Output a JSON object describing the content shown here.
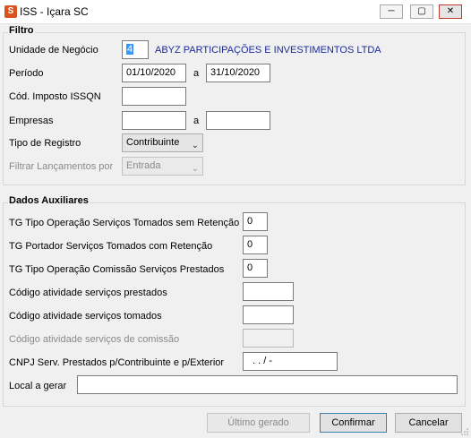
{
  "window": {
    "title": "ISS - Içara SC",
    "icon": "app-icon",
    "minimize_glyph": "─",
    "maximize_glyph": "▢",
    "close_glyph": "✕"
  },
  "filtro": {
    "title": "Filtro",
    "unidade_label": "Unidade de Negócio",
    "unidade_code": "4",
    "unidade_name": "ABYZ PARTICIPAÇÕES E INVESTIMENTOS LTDA",
    "periodo_label": "Período",
    "periodo_from": "01/10/2020",
    "periodo_sep": "a",
    "periodo_to": "31/10/2020",
    "cod_imposto_label": "Cód. Imposto ISSQN",
    "cod_imposto_value": "",
    "empresas_label": "Empresas",
    "empresas_from": "",
    "empresas_sep": "a",
    "empresas_to": "",
    "tipo_registro_label": "Tipo de Registro",
    "tipo_registro_value": "Contribuinte",
    "filtrar_label": "Filtrar Lançamentos por",
    "filtrar_value": "Entrada"
  },
  "aux": {
    "title": "Dados Auxiliares",
    "tg_tomados_label": "TG Tipo Operação Serviços Tomados sem Retenção",
    "tg_tomados_value": "0",
    "tg_portador_label": "TG Portador Serviços Tomados com Retenção",
    "tg_portador_value": "0",
    "tg_comissao_label": "TG Tipo Operação Comissão Serviços Prestados",
    "tg_comissao_value": "0",
    "cod_prestados_label": "Código atividade serviços prestados",
    "cod_prestados_value": "",
    "cod_tomados_label": "Código atividade serviços tomados",
    "cod_tomados_value": "",
    "cod_comissao_label": "Código atividade serviços de comissão",
    "cod_comissao_value": "",
    "cnpj_label": "CNPJ Serv. Prestados p/Contribuinte e p/Exterior",
    "cnpj_value": ". .  /   -",
    "local_label": "Local a gerar",
    "local_value": ""
  },
  "buttons": {
    "ultimo": "Último gerado",
    "confirmar": "Confirmar",
    "cancelar": "Cancelar"
  }
}
